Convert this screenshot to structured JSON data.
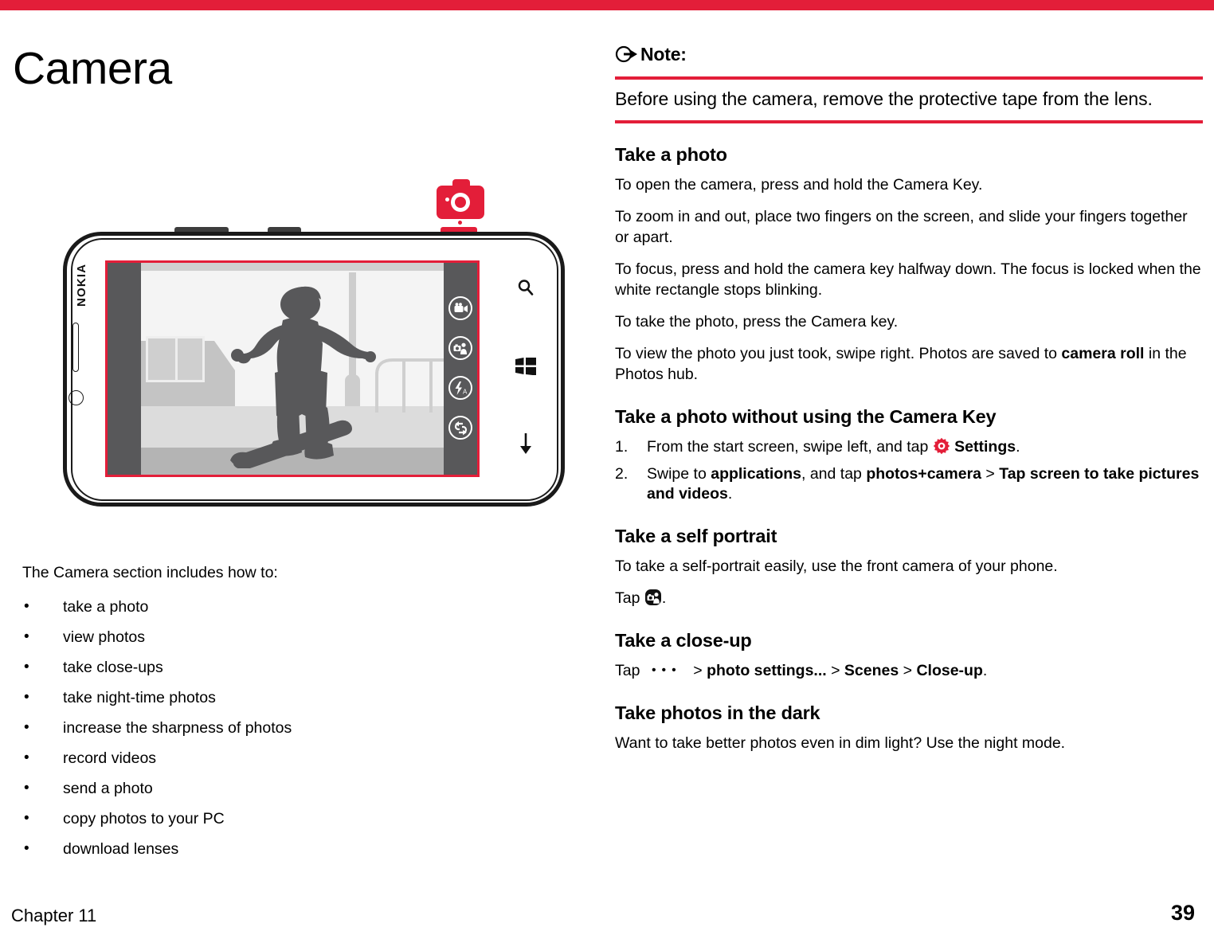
{
  "theme": {
    "accent_red": "#e31e39",
    "screen_chrome": "#58585a",
    "text_black": "#000000"
  },
  "header": {
    "title": "Camera"
  },
  "illustration": {
    "device_brand": "NOKIA",
    "camera_icon_name": "camera-icon",
    "camera_key_label": "Camera Key",
    "screen_icons": [
      {
        "name": "video-camera-icon",
        "label": "video"
      },
      {
        "name": "front-camera-icon",
        "label": "self portrait"
      },
      {
        "name": "flash-auto-icon",
        "label": "flash auto"
      },
      {
        "name": "switch-camera-icon",
        "label": "switch camera"
      }
    ],
    "hardware_keys": [
      {
        "name": "search-key-icon",
        "label": "search"
      },
      {
        "name": "start-key-icon",
        "label": "start"
      },
      {
        "name": "back-key-icon",
        "label": "back"
      }
    ],
    "scene_description": "skateboarder silhouette"
  },
  "left_column": {
    "lead_in": "The Camera section includes how to:",
    "bullets": [
      "take a photo",
      "view photos",
      "take close-ups",
      "take night-time photos",
      "increase the sharpness of photos",
      "record videos",
      "send a photo",
      "copy photos to your PC",
      "download lenses"
    ]
  },
  "right_column": {
    "note": {
      "icon_name": "note-arrow-icon",
      "heading": "Note:",
      "body": "Before using the camera, remove the protective tape from the lens."
    },
    "sections": [
      {
        "heading": "Take a photo",
        "paragraphs": [
          "To open the camera, press and hold the Camera Key.",
          "To zoom in and out, place two fingers on the screen, and slide your fingers together or apart.",
          "To focus, press and hold the camera key halfway down. The focus is locked when the white rectangle stops blinking.",
          "To take the photo, press the Camera key."
        ],
        "saved_note_prefix": "To view the photo you just took, swipe right. Photos are saved to ",
        "saved_note_bold": "camera roll",
        "saved_note_suffix": " in the Photos hub."
      },
      {
        "heading": "Take a photo without using the Camera Key",
        "steps": [
          {
            "prefix": "From the start screen, swipe left, and tap ",
            "icon_name": "settings-gear-icon",
            "bold": "Settings",
            "suffix": "."
          },
          {
            "prefix": "Swipe to ",
            "bold1": "applications",
            "mid1": ", and tap ",
            "bold2": "photos+camera",
            "mid2": " > ",
            "bold3": "Tap screen to take pictures and videos",
            "suffix": "."
          }
        ]
      },
      {
        "heading": "Take a self portrait",
        "paragraph": "To take a self-portrait easily, use the front camera of your phone.",
        "tap_prefix": "Tap ",
        "tap_icon_name": "front-camera-icon",
        "tap_suffix": "."
      },
      {
        "heading": "Take a close-up",
        "tap_prefix": "Tap ",
        "tap_icon_name": "more-dots-icon",
        "dots": "•••",
        "chain": [
          {
            "sep": " > ",
            "bold": "photo settings..."
          },
          {
            "sep": " > ",
            "bold": "Scenes"
          },
          {
            "sep": " > ",
            "bold": "Close-up"
          }
        ],
        "suffix": "."
      },
      {
        "heading": "Take photos in the dark",
        "paragraph": "Want to take better photos even in dim light? Use the night mode."
      }
    ]
  },
  "footer": {
    "chapter": "Chapter 11",
    "page_number": "39"
  }
}
